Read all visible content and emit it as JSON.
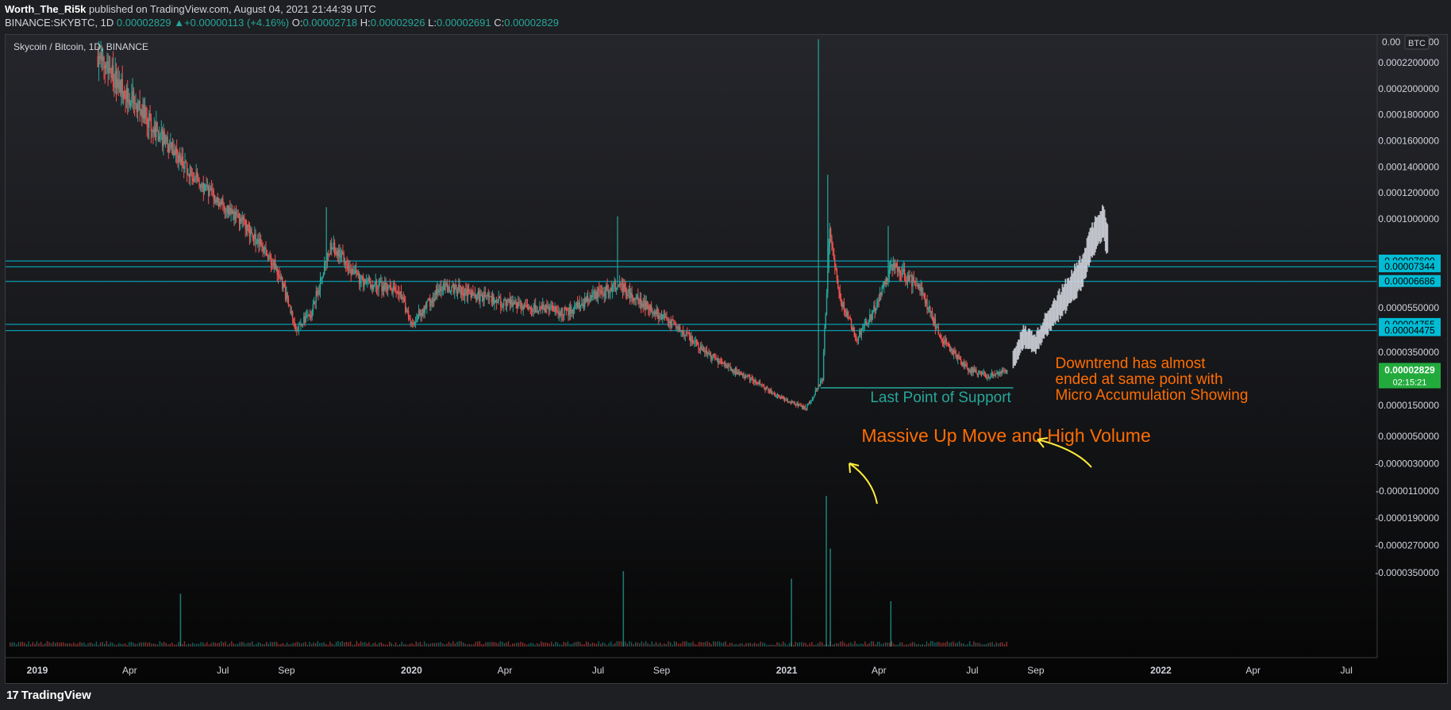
{
  "header": {
    "author": "Worth_The_Ri5k",
    "published_text": " published on TradingView.com, August 04, 2021 21:44:39 UTC",
    "symbol_line": {
      "symbol": "BINANCE:SKYBTC, 1D",
      "last": "0.00002829",
      "change": "+0.00000113 (+4.16%)",
      "open_label": "O:",
      "open": "0.00002718",
      "high_label": "H:",
      "high": "0.00002926",
      "low_label": "L:",
      "low": "0.00002691",
      "close_label": "C:",
      "close": "0.00002829"
    }
  },
  "chart_title": "Skycoin / Bitcoin, 1D, BINANCE",
  "footer": {
    "logo_mark": "17",
    "logo_text": "TradingView"
  },
  "colors": {
    "up": "#26a69a",
    "down": "#ef5350",
    "level": "#00bcd4",
    "annotation": "#ff6d00",
    "arrow": "#ffeb3b",
    "support": "#26a69a",
    "projection": "#d1d4dc"
  },
  "chart_data": {
    "type": "candlestick",
    "symbol": "SKYBTC",
    "exchange": "BINANCE",
    "timeframe": "1D",
    "currency": "BTC",
    "x_range": [
      "2018-12-01",
      "2022-07-31"
    ],
    "y_range": [
      -3.9e-05,
      0.000238
    ],
    "x_ticks": [
      "2019",
      "Apr",
      "Jul",
      "Sep",
      "2020",
      "Apr",
      "Jul",
      "Sep",
      "2021",
      "Apr",
      "Jul",
      "Sep",
      "2022",
      "Apr",
      "Jul"
    ],
    "x_tick_dates": [
      "2019-01-01",
      "2019-04-01",
      "2019-07-01",
      "2019-09-01",
      "2020-01-01",
      "2020-04-01",
      "2020-07-01",
      "2020-09-01",
      "2021-01-01",
      "2021-04-01",
      "2021-07-01",
      "2021-09-01",
      "2022-01-01",
      "2022-04-01",
      "2022-07-01"
    ],
    "y_ticks": [
      "0.0002200000",
      "0.0002000000",
      "0.0001800000",
      "0.0001600000",
      "0.0001400000",
      "0.0001200000",
      "0.0001000000",
      "0.0000550000",
      "0.0000350000",
      "0.0000150000",
      "0.0000050000",
      "-0.0000030000",
      "-0.0000110000",
      "-0.0000190000",
      "-0.0000270000",
      "-0.0000350000"
    ],
    "y_tick_values": [
      0.00022,
      0.0002,
      0.00018,
      0.00016,
      0.00014,
      0.00012,
      0.0001,
      5.5e-05,
      3.5e-05,
      1.5e-05,
      5e-06,
      -3e-06,
      -1.1e-05,
      -1.9e-05,
      -2.7e-05,
      -3.5e-05
    ],
    "y_axis_top_label": "0.00",
    "y_axis_top_label_right": "00",
    "unit_label": "BTC",
    "price_path": [
      [
        "2019-03-01",
        0.000225
      ],
      [
        "2019-04-05",
        0.00019
      ],
      [
        "2019-05-15",
        0.00015
      ],
      [
        "2019-06-20",
        0.000118
      ],
      [
        "2019-07-25",
        9.5e-05
      ],
      [
        "2019-08-25",
        7e-05
      ],
      [
        "2019-09-10",
        4.6e-05
      ],
      [
        "2019-09-25",
        5.2e-05
      ],
      [
        "2019-10-15",
        8.5e-05
      ],
      [
        "2019-11-10",
        6.8e-05
      ],
      [
        "2019-12-20",
        6.2e-05
      ],
      [
        "2020-01-01",
        4.8e-05
      ],
      [
        "2020-02-01",
        6.5e-05
      ],
      [
        "2020-04-01",
        5.7e-05
      ],
      [
        "2020-06-01",
        5.3e-05
      ],
      [
        "2020-07-20",
        6.6e-05
      ],
      [
        "2020-08-10",
        5.8e-05
      ],
      [
        "2020-09-20",
        4.5e-05
      ],
      [
        "2020-10-20",
        3.3e-05
      ],
      [
        "2020-12-01",
        2.4e-05
      ],
      [
        "2020-12-25",
        1.8e-05
      ],
      [
        "2021-01-20",
        1.4e-05
      ],
      [
        "2021-02-05",
        2.5e-05
      ],
      [
        "2021-02-12",
        9.2e-05
      ],
      [
        "2021-02-20",
        6.2e-05
      ],
      [
        "2021-03-10",
        4.1e-05
      ],
      [
        "2021-03-25",
        5.2e-05
      ],
      [
        "2021-04-15",
        7.4e-05
      ],
      [
        "2021-05-10",
        6.4e-05
      ],
      [
        "2021-06-01",
        4.1e-05
      ],
      [
        "2021-06-25",
        2.9e-05
      ],
      [
        "2021-07-15",
        2.6e-05
      ],
      [
        "2021-08-04",
        2.8e-05
      ]
    ],
    "projection_path": [
      [
        "2021-08-10",
        3.3e-05
      ],
      [
        "2021-08-20",
        4.3e-05
      ],
      [
        "2021-09-01",
        4e-05
      ],
      [
        "2021-09-15",
        5.2e-05
      ],
      [
        "2021-10-01",
        6.2e-05
      ],
      [
        "2021-10-15",
        7.2e-05
      ],
      [
        "2021-10-25",
        8.8e-05
      ],
      [
        "2021-11-05",
        0.000103
      ],
      [
        "2021-11-10",
        9.1e-05
      ]
    ],
    "spikes": [
      {
        "date": "2019-10-10",
        "high": 0.000109
      },
      {
        "date": "2020-07-20",
        "high": 0.000102
      },
      {
        "date": "2021-02-01",
        "high": 0.000238
      },
      {
        "date": "2021-02-10",
        "high": 0.000134
      },
      {
        "date": "2021-04-10",
        "high": 9.6e-05
      }
    ],
    "volume_spikes": [
      {
        "date": "2019-05-20",
        "level": 0.35
      },
      {
        "date": "2020-07-25",
        "level": 0.5
      },
      {
        "date": "2021-01-05",
        "level": 0.45
      },
      {
        "date": "2021-02-08",
        "level": 1.0
      },
      {
        "date": "2021-02-12",
        "level": 0.65
      },
      {
        "date": "2021-04-12",
        "level": 0.3
      }
    ],
    "levels": [
      {
        "price": 7.6e-05,
        "label": "0.00007600"
      },
      {
        "price": 7.344e-05,
        "label": "0.00007344"
      },
      {
        "price": 6.686e-05,
        "label": "0.00006686"
      },
      {
        "price": 4.755e-05,
        "label": "0.00004755"
      },
      {
        "price": 4.475e-05,
        "label": "0.00004475"
      }
    ],
    "support_level": {
      "price": 2.16e-05,
      "label": "Last Point of Support",
      "from": "2021-02-03",
      "to": "2021-08-10"
    },
    "last_price": {
      "label": "0.00002829",
      "countdown": "02:15:21",
      "price": 2.829e-05
    },
    "annotations": [
      {
        "text": "Massive Up Move and High Volume",
        "date": "2021-03-15",
        "price": 3.4e-06
      },
      {
        "lines": [
          "Downtrend has almost",
          "ended at same point with",
          "Micro Accumulation Showing"
        ],
        "date": "2021-09-20",
        "price": 2.9e-05
      }
    ]
  }
}
